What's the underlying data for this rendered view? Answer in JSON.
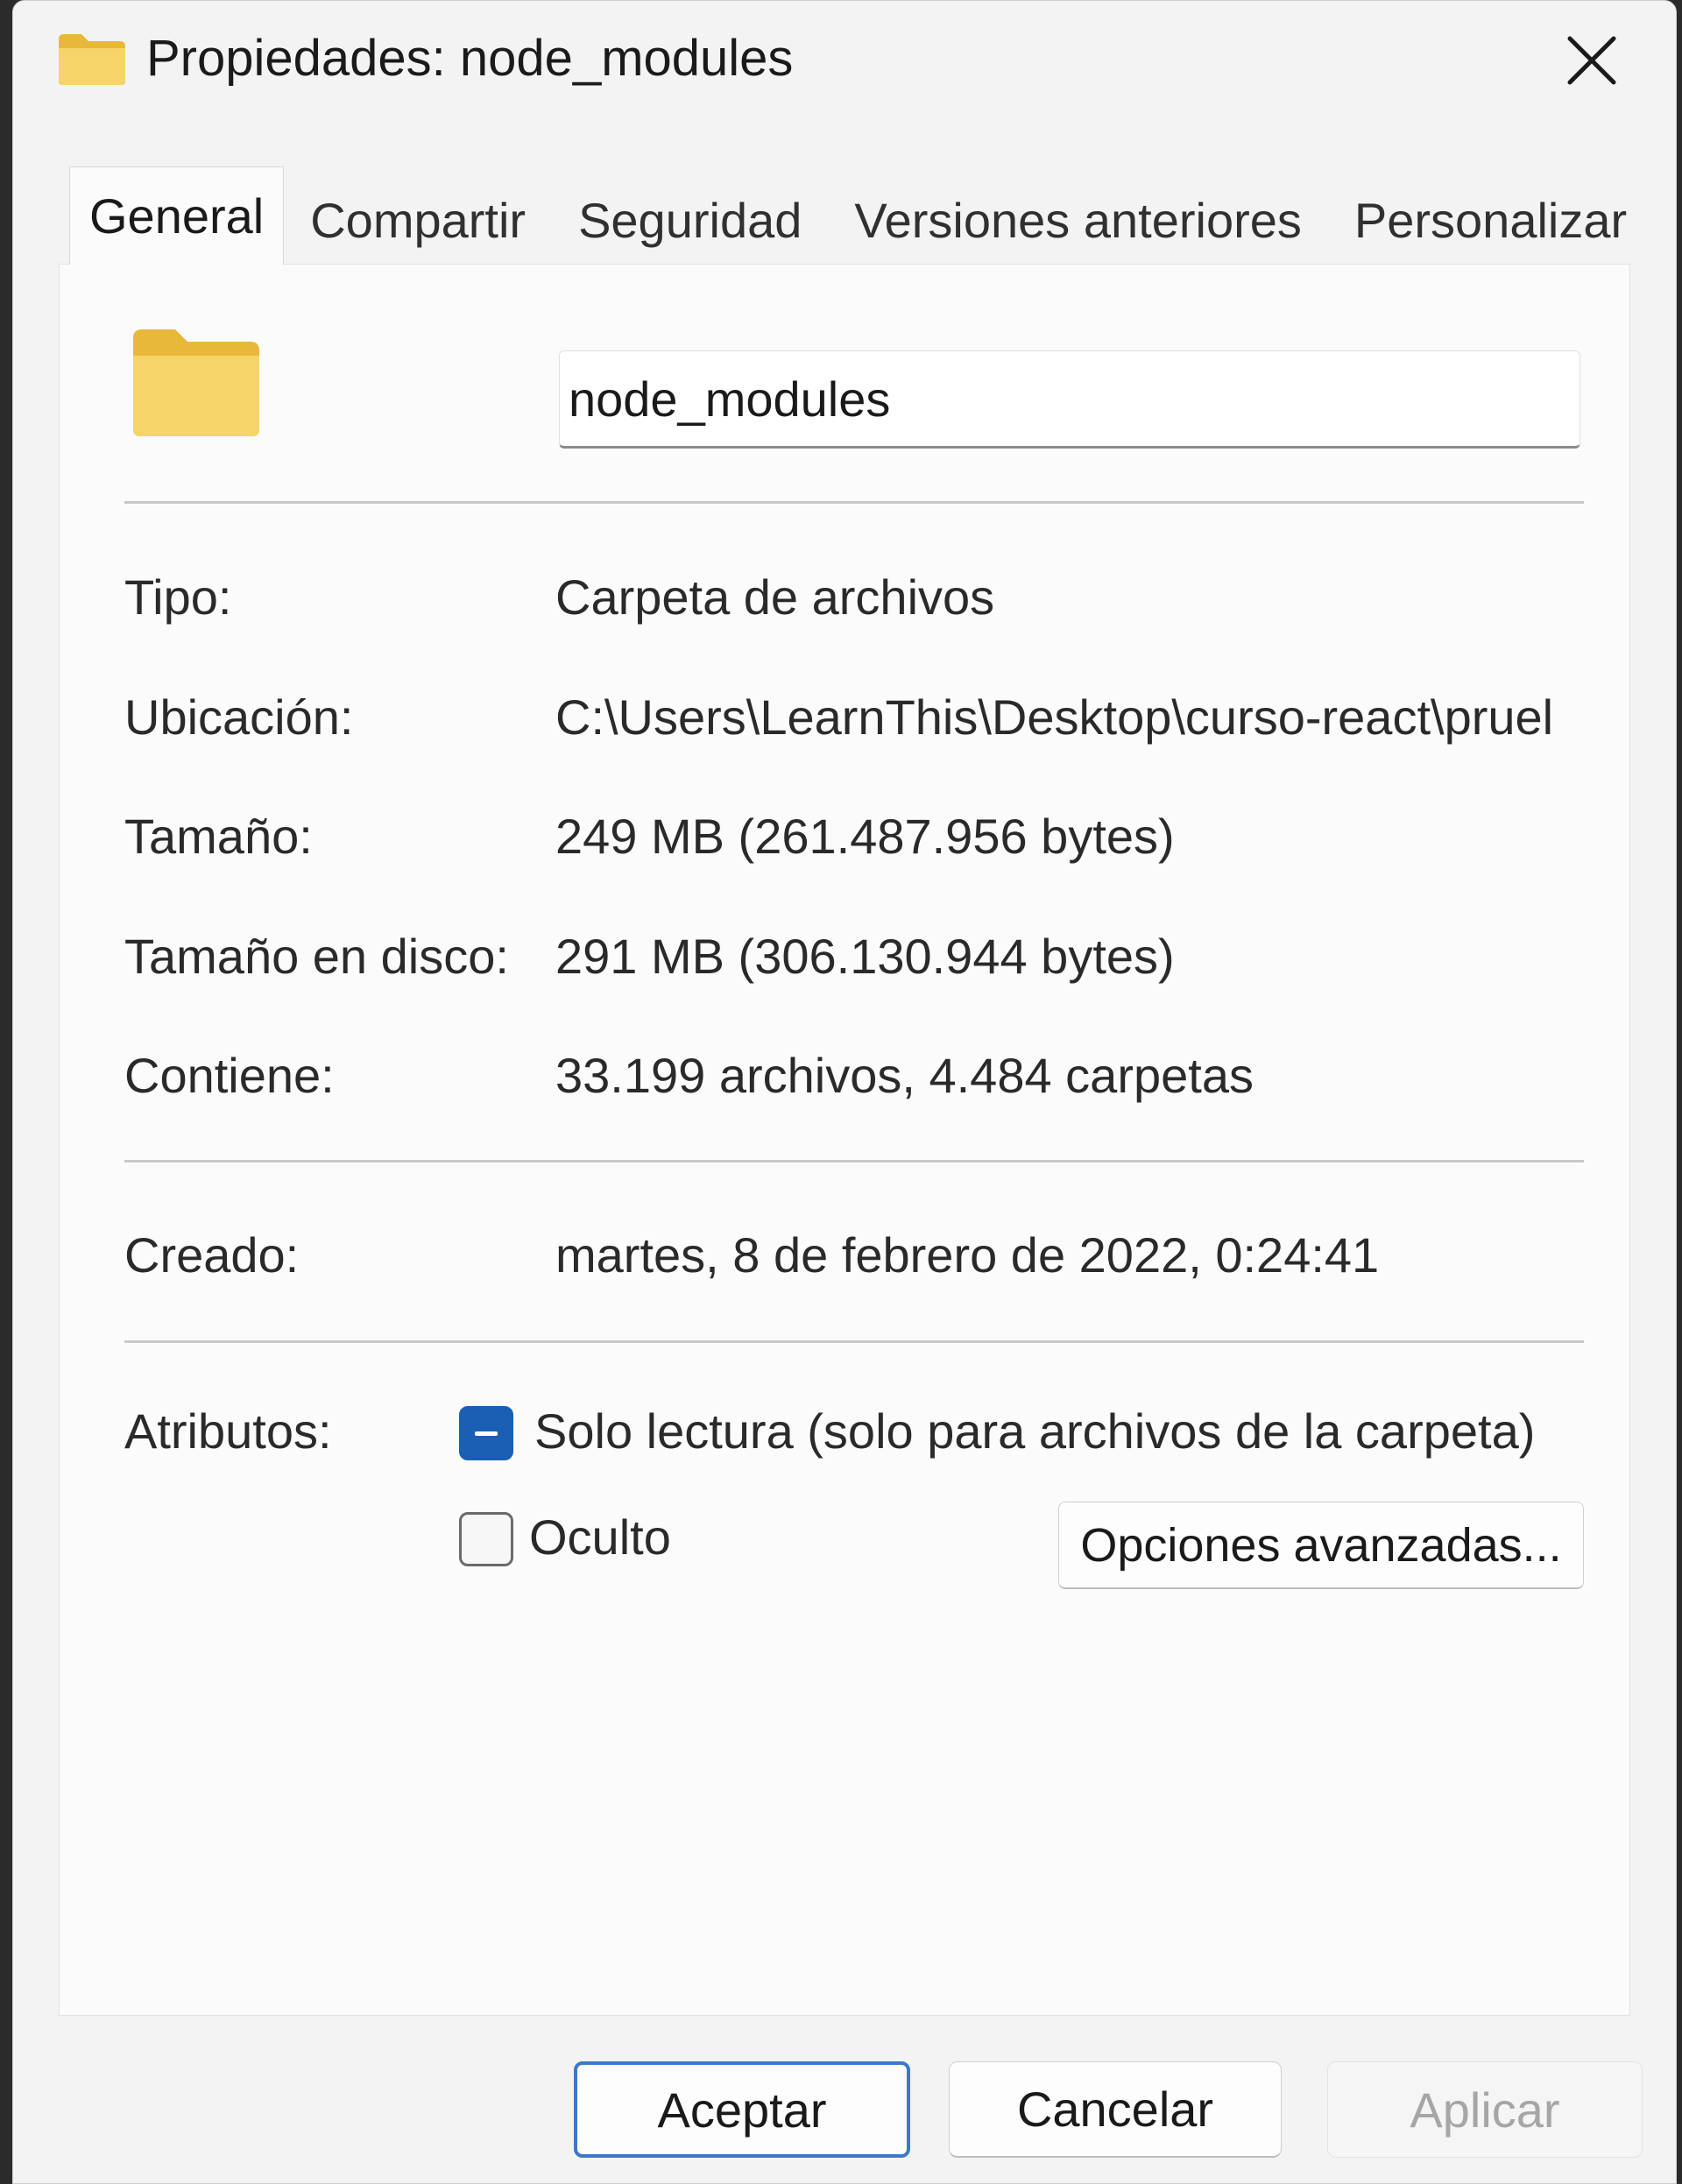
{
  "window": {
    "title": "Propiedades: node_modules"
  },
  "tabs": [
    {
      "label": "General",
      "active": true
    },
    {
      "label": "Compartir",
      "active": false
    },
    {
      "label": "Seguridad",
      "active": false
    },
    {
      "label": "Versiones anteriores",
      "active": false
    },
    {
      "label": "Personalizar",
      "active": false
    }
  ],
  "general": {
    "name_value": "node_modules",
    "rows": {
      "tipo": {
        "label": "Tipo:",
        "value": "Carpeta de archivos"
      },
      "ubicacion": {
        "label": "Ubicación:",
        "value": "C:\\Users\\LearnThis\\Desktop\\curso-react\\pruel"
      },
      "tamano": {
        "label": "Tamaño:",
        "value": "249 MB (261.487.956 bytes)"
      },
      "tamano_disco": {
        "label": "Tamaño en disco:",
        "value": "291 MB (306.130.944 bytes)"
      },
      "contiene": {
        "label": "Contiene:",
        "value": "33.199 archivos, 4.484 carpetas"
      },
      "creado": {
        "label": "Creado:",
        "value": "martes, 8 de febrero de 2022, 0:24:41"
      }
    },
    "attributes": {
      "label": "Atributos:",
      "readonly": {
        "label": "Solo lectura (solo para archivos de la carpeta)",
        "state": "indeterminate"
      },
      "hidden": {
        "label": "Oculto",
        "state": "unchecked"
      },
      "advanced_button": "Opciones avanzadas..."
    }
  },
  "footer": {
    "ok": "Aceptar",
    "cancel": "Cancelar",
    "apply": "Aplicar"
  },
  "colors": {
    "accent": "#1a5fb4",
    "folder_yellow": "#f4cd55",
    "window_bg": "#f3f3f3",
    "panel_bg": "#fbfbfb"
  },
  "icons": {
    "title_icon": "folder-icon",
    "close": "close-icon",
    "main_icon": "folder-icon"
  }
}
